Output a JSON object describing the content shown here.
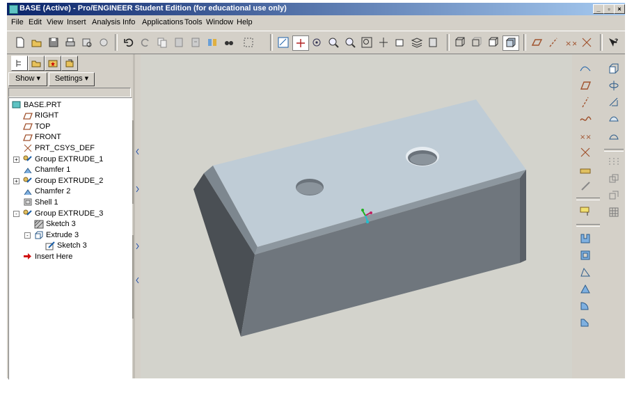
{
  "window": {
    "title": "BASE (Active) - Pro/ENGINEER Student Edition (for educational use only)",
    "controls": [
      "_",
      "▫",
      "×"
    ]
  },
  "menubar": {
    "items": [
      "File",
      "Edit",
      "View",
      "Insert",
      "Analysis",
      "Info",
      "Applications",
      "Tools",
      "Window",
      "Help"
    ]
  },
  "toolbar": {
    "icons": [
      "new-icon",
      "open-icon",
      "save-icon",
      "print-icon",
      "preview-icon",
      "email-icon",
      "undo-icon",
      "redo-icon",
      "copy-icon",
      "paste-icon",
      "paste-special-icon",
      "regenerate-icon",
      "find-icon",
      "select-box-icon",
      "datum-display-icon",
      "csys-display-icon",
      "spin-center-icon",
      "zoom-in-icon",
      "zoom-out-icon",
      "refit-icon",
      "reorient-icon",
      "saved-views-icon",
      "layers-icon",
      "view-manager-icon",
      "wireframe-icon",
      "hidden-line-icon",
      "no-hidden-icon",
      "shading-icon",
      "datum-plane-toggle-icon",
      "datum-axis-toggle-icon",
      "datum-point-toggle-icon",
      "csys-toggle-icon",
      "whats-this-icon"
    ]
  },
  "left_panel": {
    "show_label": "Show",
    "settings_label": "Settings",
    "tabs": [
      "model-tree-tab",
      "folder-browser-tab",
      "favorites-tab",
      "connections-tab"
    ],
    "tree": [
      {
        "label": "BASE.PRT",
        "icon": "part-icon",
        "level": 0
      },
      {
        "label": "RIGHT",
        "icon": "datum-plane-icon",
        "level": 1
      },
      {
        "label": "TOP",
        "icon": "datum-plane-icon",
        "level": 1
      },
      {
        "label": "FRONT",
        "icon": "datum-plane-icon",
        "level": 1
      },
      {
        "label": "PRT_CSYS_DEF",
        "icon": "csys-icon",
        "level": 1
      },
      {
        "label": "Group EXTRUDE_1",
        "icon": "group-icon",
        "level": 1,
        "expander": "+"
      },
      {
        "label": "Chamfer 1",
        "icon": "chamfer-icon",
        "level": 1
      },
      {
        "label": "Group EXTRUDE_2",
        "icon": "group-icon",
        "level": 1,
        "expander": "+"
      },
      {
        "label": "Chamfer 2",
        "icon": "chamfer-icon",
        "level": 1
      },
      {
        "label": "Shell 1",
        "icon": "shell-icon",
        "level": 1
      },
      {
        "label": "Group EXTRUDE_3",
        "icon": "group-icon",
        "level": 1,
        "expander": "-"
      },
      {
        "label": "Sketch 3",
        "icon": "sketch-hatch-icon",
        "level": 2
      },
      {
        "label": "Extrude 3",
        "icon": "extrude-icon",
        "level": 2,
        "expander": "-"
      },
      {
        "label": "Sketch 3",
        "icon": "sketch-icon",
        "level": 3
      },
      {
        "label": "Insert Here",
        "icon": "insert-arrow-icon",
        "level": 1
      }
    ]
  },
  "right_toolbar_1": {
    "icons": [
      "sketched-datum-curve-icon",
      "datum-plane-tool-icon",
      "datum-axis-tool-icon",
      "datum-curve-icon",
      "datum-point-icon",
      "csys-tool-icon",
      "analysis-feature-icon",
      "sketch-tool-icon",
      "hole-tool-icon",
      "shell-tool-icon",
      "rib-tool-icon",
      "draft-tool-icon",
      "round-tool-icon",
      "chamfer-tool-icon"
    ]
  },
  "right_toolbar_2": {
    "icons": [
      "extrude-tool-icon",
      "revolve-tool-icon",
      "variable-sweep-icon",
      "boundary-blend-icon",
      "style-icon",
      "mirror-tool-icon",
      "merge-tool-icon",
      "trim-tool-icon",
      "pattern-tool-icon"
    ]
  },
  "colors": {
    "title_start": "#0a246a",
    "title_end": "#a6caf0",
    "chrome": "#d4d0c8",
    "viewport_bg": "#d3d3cc",
    "model_top": "#bfccd6",
    "model_front": "#6f767d",
    "model_side": "#4a4f54"
  }
}
